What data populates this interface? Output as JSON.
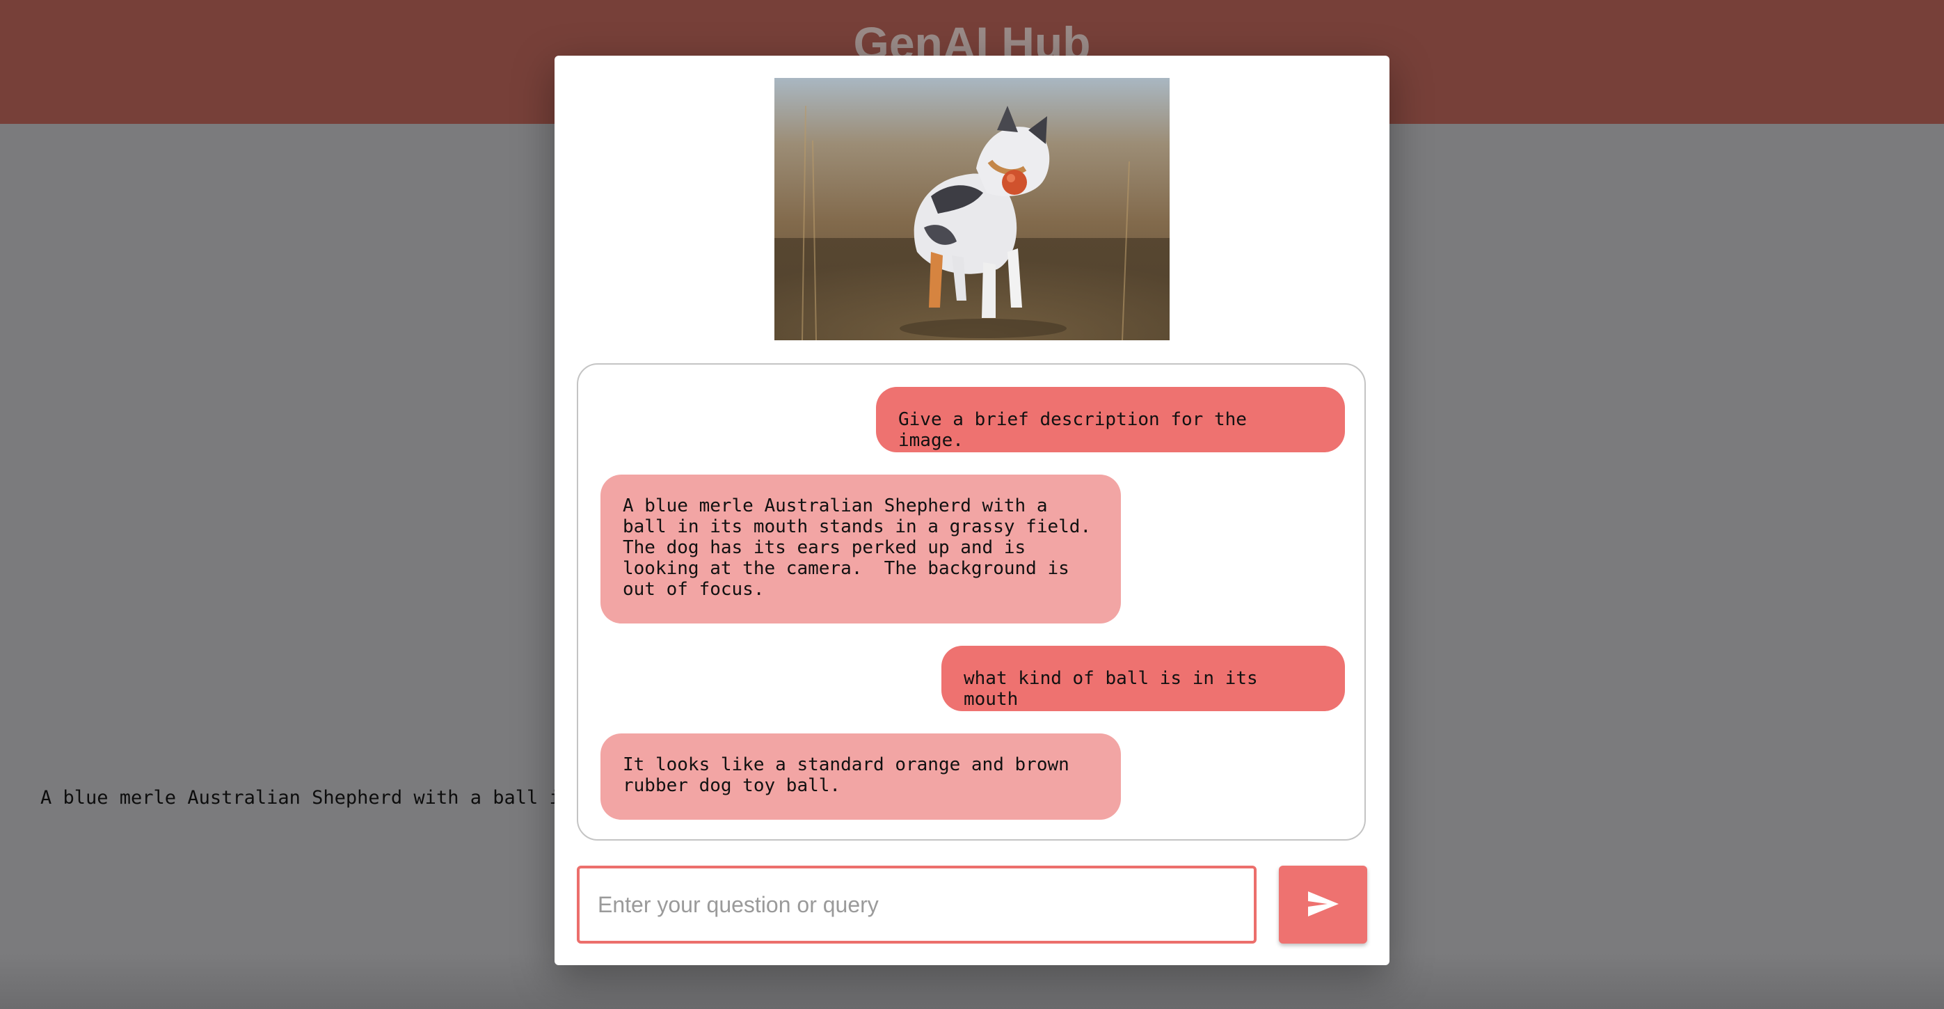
{
  "app": {
    "title": "GenAI Hub"
  },
  "background": {
    "caption": "A blue merle Australian Shepherd with a ball in                                                                                 looking at the camera.  The background is out of"
  },
  "modal": {
    "image": {
      "alt": "Blue merle Australian Shepherd holding an orange ball in a grassy field"
    },
    "chat": {
      "messages": [
        {
          "role": "user",
          "text": "Give a brief description for the image."
        },
        {
          "role": "assistant",
          "text": "A blue merle Australian Shepherd with a\nball in its mouth stands in a grassy field.\nThe dog has its ears perked up and is\nlooking at the camera.  The background is\nout of focus."
        },
        {
          "role": "user",
          "text": "what kind of ball is in its mouth"
        },
        {
          "role": "assistant",
          "text": "It looks like a standard orange and brown\nrubber dog toy ball."
        }
      ]
    },
    "input": {
      "placeholder": "Enter your question or query",
      "value": ""
    },
    "send": {
      "icon": "send-icon"
    }
  },
  "colors": {
    "header": "#774039",
    "user_bubble": "#ee7270",
    "assistant_bubble": "#f2a5a4",
    "accent": "#ec6f6c",
    "overlay": "#7b7b7d"
  }
}
